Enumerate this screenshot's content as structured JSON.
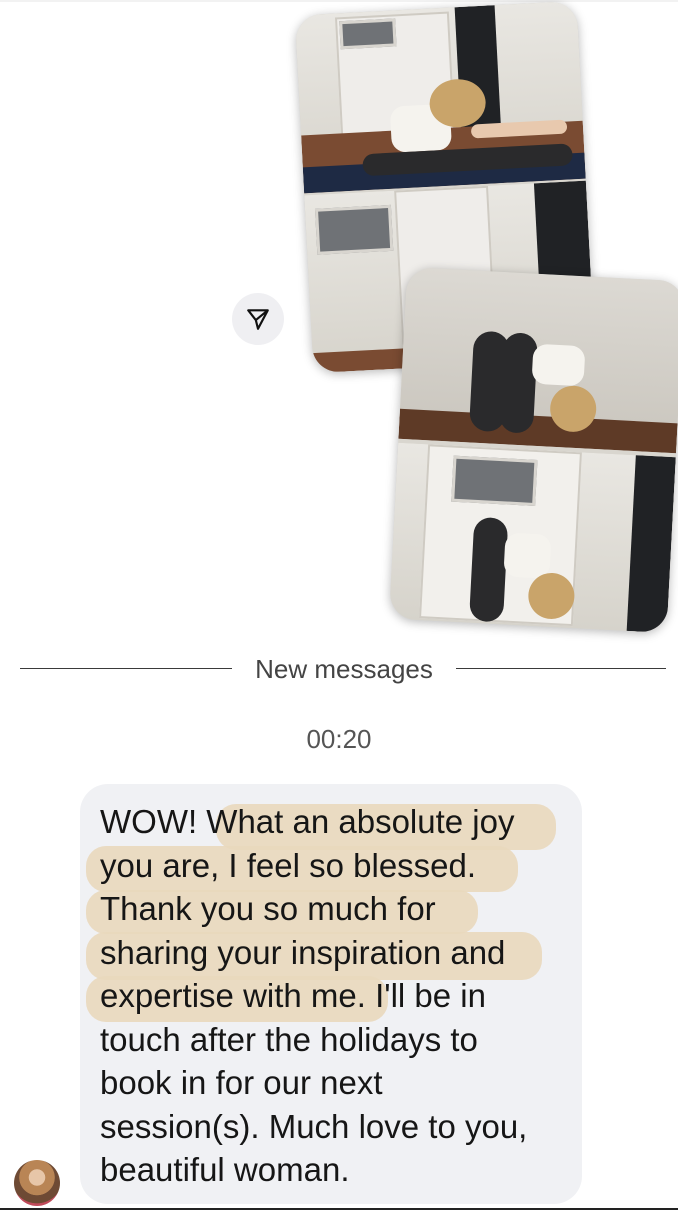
{
  "thread": {
    "divider_label": "New messages",
    "timestamp": "00:20"
  },
  "message": {
    "text": "WOW! What an absolute joy\nyou are, I feel so blessed.\nThank you so much for\nsharing your inspiration and\nexpertise with me. I'll be in\ntouch after the holidays to\nbook in for our next\nsession(s). Much love to you,\nbeautiful woman."
  },
  "icons": {
    "share": "paper-plane-icon",
    "avatar": "avatar"
  },
  "colors": {
    "bubble": "#f0f1f4",
    "highlight": "#e9d8bd"
  }
}
